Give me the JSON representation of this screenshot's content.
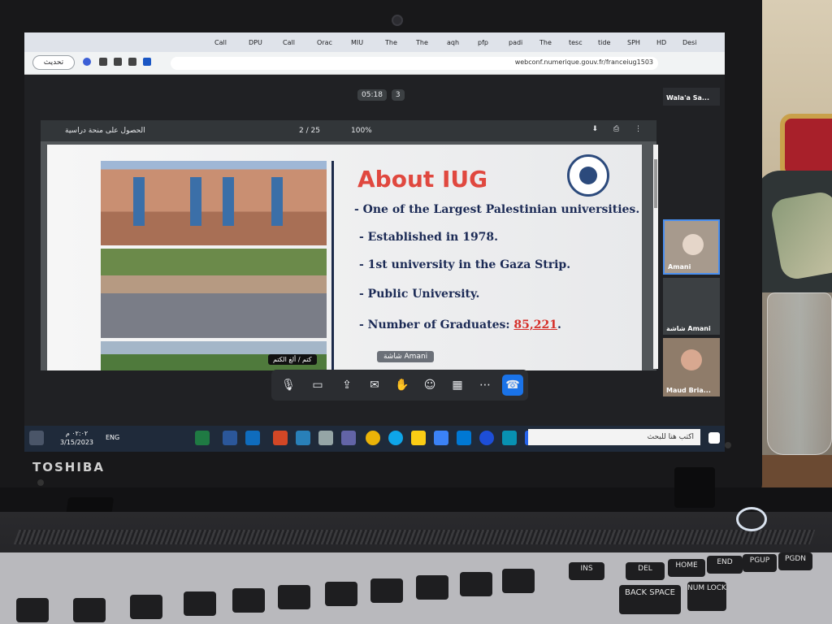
{
  "laptop": {
    "brand": "TOSHIBA"
  },
  "browser": {
    "tabs": [
      "Call",
      "DPU",
      "Call",
      "Orac",
      "MIU",
      "The",
      "The",
      "aqh",
      "pfp",
      "padi",
      "The",
      "tesc",
      "tide",
      "SPH",
      "HD",
      "Desi"
    ],
    "update_button": "تحديث",
    "url": "webconf.numerique.gouv.fr/franceiug1503"
  },
  "meeting": {
    "timer": "05:18",
    "participant_count": "3",
    "pdf": {
      "title": "الحصول على منحة دراسية",
      "page_current": "2",
      "page_total": "25",
      "zoom": "100%"
    },
    "slide": {
      "title": "About IUG",
      "bullets": [
        "- One of the Largest Palestinian universities.",
        "- Established in 1978.",
        "- 1st  university in the Gaza Strip.",
        "- Public University."
      ],
      "graduates_label": "- Number of Graduates:",
      "graduates_value": "85,221",
      "speaker_label": "شاشة Amani"
    },
    "participants": [
      {
        "name": "Wala'a Sa..."
      },
      {
        "name": "Amani"
      },
      {
        "name": "شاشة Amani"
      },
      {
        "name": "Maud Bria..."
      }
    ],
    "mic_tooltip": "كتم / ألغ الكتم"
  },
  "taskbar": {
    "search_placeholder": "اكتب هنا للبحث",
    "language": "ENG",
    "time": "٠٢:٠٢ م",
    "date": "3/15/2023"
  },
  "keyboard": {
    "keys": [
      "INS",
      "DEL",
      "HOME",
      "END",
      "PGUP",
      "PGDN",
      "BACK SPACE",
      "NUM LOCK"
    ]
  }
}
